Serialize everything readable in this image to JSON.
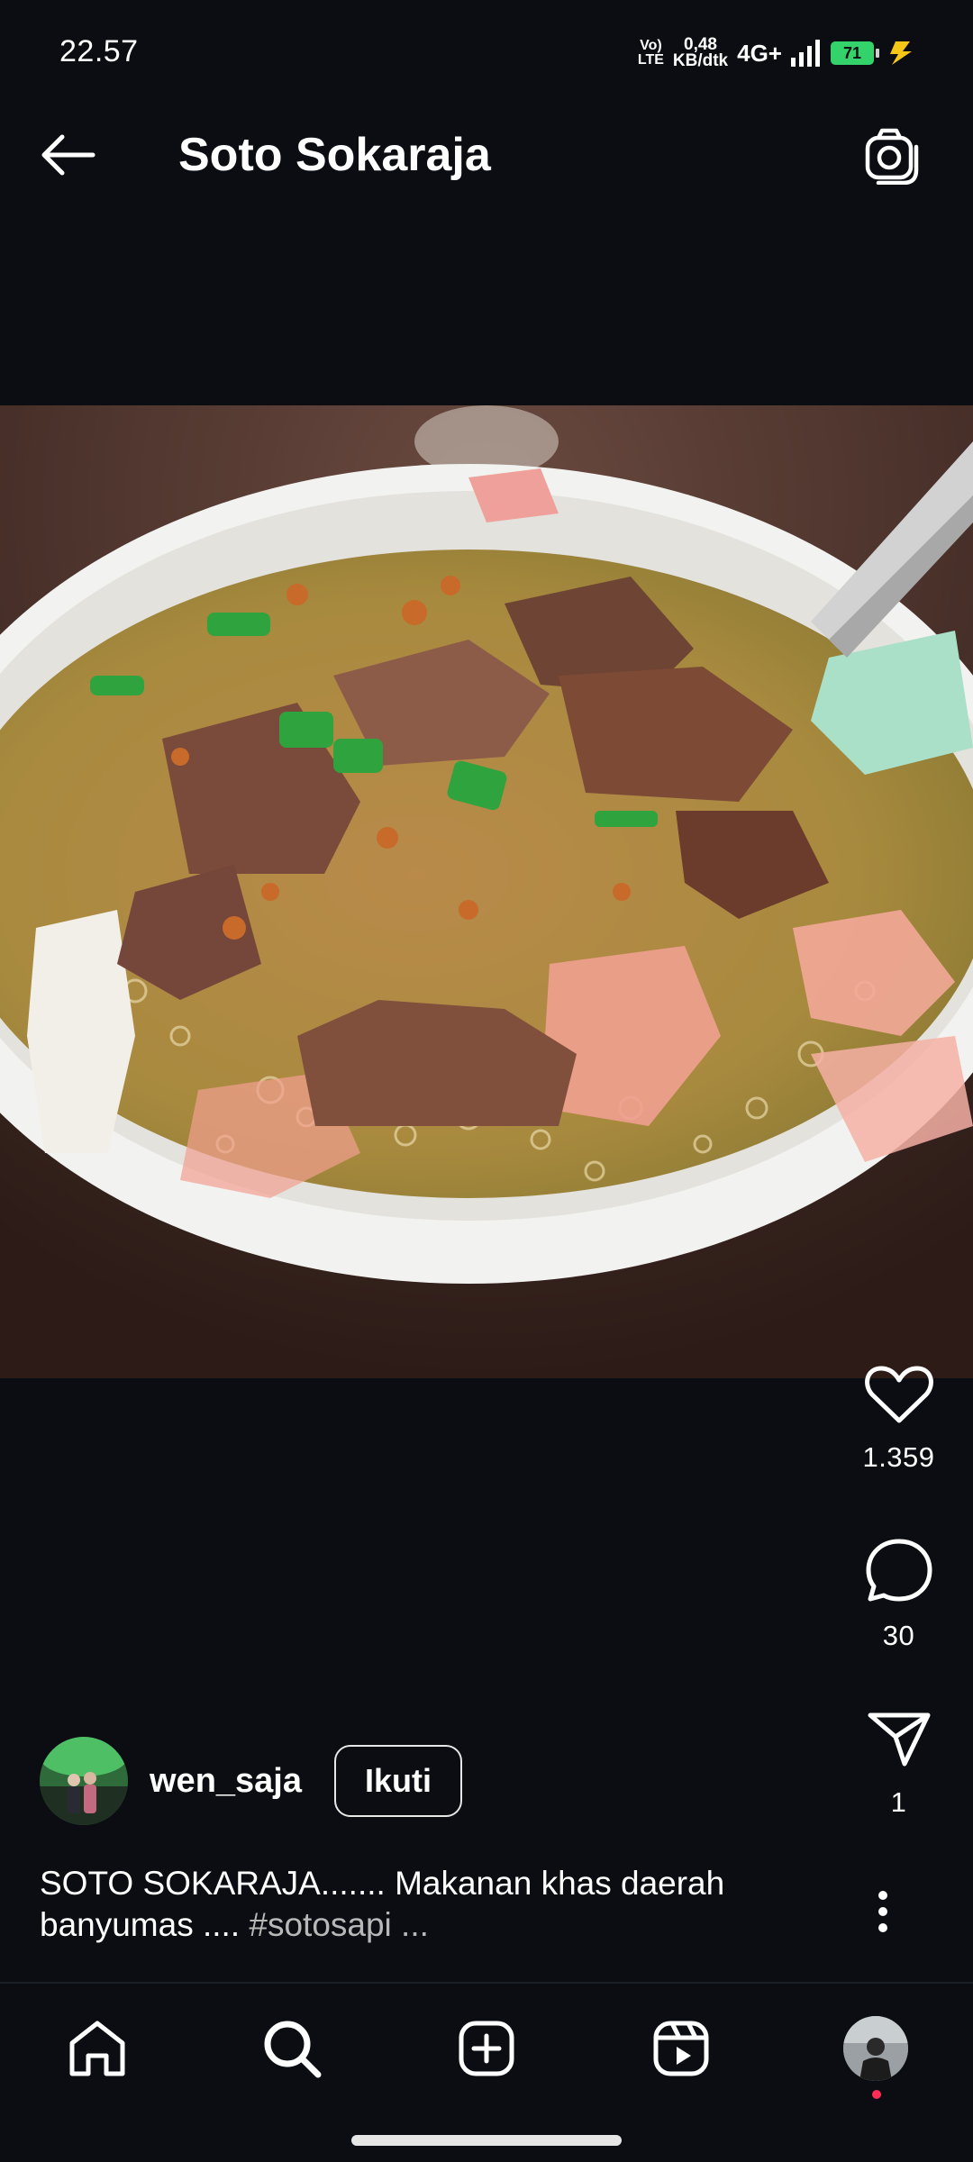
{
  "status_bar": {
    "time": "22.57",
    "volte_line1": "Vo)",
    "volte_line2": "LTE",
    "speed_line1": "0,48",
    "speed_line2": "KB/dtk",
    "network": "4G+",
    "battery": "71",
    "icons": [
      "signal-icon",
      "charging-icon"
    ]
  },
  "header": {
    "title": "Soto Sokaraja",
    "back_icon": "arrow-left-icon",
    "camera_icon": "camera-icon"
  },
  "post": {
    "actions": {
      "likes": "1.359",
      "comments": "30",
      "shares": "1"
    },
    "user": {
      "username": "wen_saja",
      "follow_label": "Ikuti"
    },
    "caption": {
      "text": "SOTO SOKARAJA....... Makanan khas daerah banyumas .... ",
      "hashtag": "#sotosapi",
      "more": " ..."
    }
  },
  "bottom_nav": {
    "items": [
      "home-icon",
      "search-icon",
      "create-icon",
      "reels-icon",
      "profile-avatar"
    ]
  },
  "colors": {
    "background": "#0b0d12",
    "text": "#ffffff",
    "muted": "#b8b8b8",
    "battery": "#33d26a",
    "charging": "#f5c518",
    "notification_dot": "#ff2d55"
  }
}
